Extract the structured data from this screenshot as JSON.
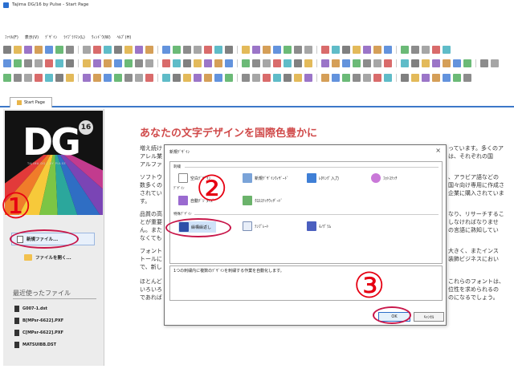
{
  "window": {
    "title": "Tajima DG/16 by Pulse - Start Page"
  },
  "menu": [
    "ﾌｧｲﾙ(F)",
    "表示(V)",
    "ﾃﾞｻﾞｲﾝ",
    "ﾗｲﾌﾞﾗﾘﾏﾝ(L)",
    "ｳｨﾝﾄﾞｳ(W)",
    "ﾍﾙﾌﾟ(H)"
  ],
  "tab": {
    "label": "Start Page"
  },
  "sidebar": {
    "logo_text": "DG",
    "logo_badge": "16",
    "logo_sub": "TAJIMA DG | BY PULSE",
    "new_file": "新規ファイル...",
    "open_file": "ファイルを開く...",
    "recent_title": "最近使ったファイル",
    "recent_files": [
      "G007-1.dst",
      "B[MPsr-6622].PXF",
      "C[MPsr-6622].PXF",
      "MATSUIBB.DST"
    ]
  },
  "main": {
    "heading": "あなたの文字デザインを国際色豊かに",
    "left_paras": [
      [
        "増え続け",
        "アレル業",
        "アルファ"
      ],
      [
        "ソフトウ",
        "数多くの",
        "されてい",
        "す。"
      ],
      [
        "品質の高",
        "とが重要",
        "ん。また",
        "なくても"
      ],
      [
        "フォント",
        "トールに",
        "で、新し"
      ],
      [
        "ほとんど",
        "いろいろ",
        "であれば"
      ]
    ],
    "right_paras": [
      [
        "っています。多くのア",
        "は、それぞれの国"
      ],
      [
        "、アラビア語などの",
        "国々向け専用に作成さ",
        "企業に購入されていま"
      ],
      [
        "なり、リサーチするこ",
        "しなければなりませ",
        "の言語に熟知してい"
      ],
      [
        "大きく、またインス",
        "装飾ビジネスにおい"
      ],
      [
        "これらのフォントは、",
        "位性を求められるの",
        "のになるでしょう。"
      ]
    ]
  },
  "dialog": {
    "title": "新規ﾃﾞｻﾞｲﾝ",
    "close": "×",
    "group1": "刺繍",
    "group2": "ﾃﾞｻﾞｲﾝ",
    "group3": "特殊ﾃﾞｻﾞｲﾝ",
    "options": {
      "blank": "空白ﾃﾞｻﾞｲﾝ",
      "wizard": "新規ﾃﾞｻﾞｲﾝｳｨｻﾞｰﾄﾞ",
      "lettering": "ﾚﾀﾘﾝｸﾞ入力",
      "photostitch": "ﾌｫﾄｽﾃｯﾁ",
      "autodigitize": "自動ﾃﾞｼﾞﾀｲｽﾞ",
      "crossstitch": "ｸﾛｽｽﾃｯﾁｳｨｻﾞｰﾄﾞ",
      "repeat": "繰構繰返し",
      "template": "ﾃﾝﾌﾟﾚｰﾄ",
      "monogram": "ﾓﾉｸﾞﾗﾑ"
    },
    "description": "1つの刺繍内に複数のﾃﾞｻﾞｲﾝを刺繍する作業を自動化します。",
    "ok": "OK",
    "cancel": "ｷｬﾝｾﾙ"
  },
  "annotations": {
    "step1": "①",
    "step2": "②",
    "step3": "③"
  }
}
